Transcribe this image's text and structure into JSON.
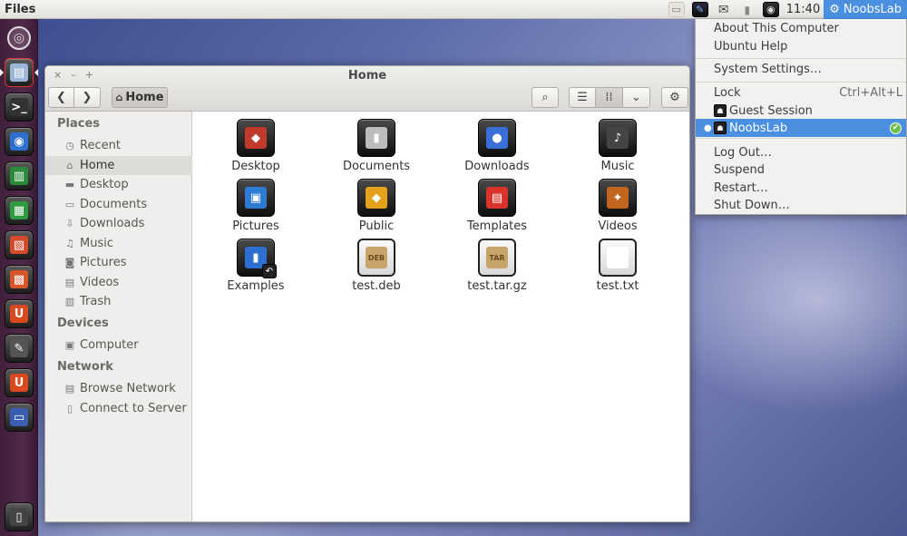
{
  "top_panel": {
    "app_title": "Files",
    "clock": "11:40",
    "session_label": "NoobsLab",
    "indicators": [
      "keyboard-icon",
      "pidgin-icon",
      "mail-icon",
      "battery-icon",
      "sound-icon"
    ]
  },
  "launcher": {
    "items": [
      {
        "name": "dash-home-icon",
        "glyph": "◎"
      },
      {
        "name": "files-app-icon",
        "glyph": "▤"
      },
      {
        "name": "terminal-icon",
        "glyph": ">_"
      },
      {
        "name": "firefox-icon",
        "glyph": "◉"
      },
      {
        "name": "libreoffice-writer-icon",
        "glyph": "▥"
      },
      {
        "name": "libreoffice-calc-icon",
        "glyph": "▦"
      },
      {
        "name": "libreoffice-impress-icon",
        "glyph": "▧"
      },
      {
        "name": "software-center-icon",
        "glyph": "▩"
      },
      {
        "name": "ubuntu-one-icon",
        "glyph": "U"
      },
      {
        "name": "system-settings-icon",
        "glyph": "✎"
      },
      {
        "name": "ubuntu-one-music-icon",
        "glyph": "U"
      },
      {
        "name": "workspace-switcher-icon",
        "glyph": "▭"
      },
      {
        "name": "trash-icon",
        "glyph": "▯"
      }
    ]
  },
  "window": {
    "title": "Home",
    "controls": {
      "close": "×",
      "minimize": "–",
      "maximize": "+"
    },
    "toolbar": {
      "back_glyph": "❮",
      "forward_glyph": "❯",
      "home_label": "Home",
      "home_glyph": "⌂",
      "search_glyph": "⌕",
      "list_glyph": "☰",
      "grid_glyph": "⁞⁞",
      "menu_glyph": "⌄",
      "gear_glyph": "⚙"
    }
  },
  "sidebar": {
    "places_header": "Places",
    "places": [
      {
        "label": "Recent",
        "icon": "recent-icon",
        "glyph": "◷"
      },
      {
        "label": "Home",
        "icon": "home-icon",
        "glyph": "⌂"
      },
      {
        "label": "Desktop",
        "icon": "desktop-folder-icon",
        "glyph": "▬"
      },
      {
        "label": "Documents",
        "icon": "documents-icon",
        "glyph": "▭"
      },
      {
        "label": "Downloads",
        "icon": "downloads-icon",
        "glyph": "⇩"
      },
      {
        "label": "Music",
        "icon": "music-icon",
        "glyph": "♫"
      },
      {
        "label": "Pictures",
        "icon": "pictures-icon",
        "glyph": "◙"
      },
      {
        "label": "Videos",
        "icon": "videos-icon",
        "glyph": "▤"
      },
      {
        "label": "Trash",
        "icon": "trash-icon",
        "glyph": "▥"
      }
    ],
    "devices_header": "Devices",
    "devices": [
      {
        "label": "Computer",
        "icon": "computer-icon",
        "glyph": "▣"
      }
    ],
    "network_header": "Network",
    "network": [
      {
        "label": "Browse Network",
        "icon": "network-icon",
        "glyph": "▤"
      },
      {
        "label": "Connect to Server",
        "icon": "server-icon",
        "glyph": "▯"
      }
    ]
  },
  "files": [
    {
      "name": "Desktop",
      "icon": "desktop-folder-icon",
      "glyph": "◆",
      "color": "#c0392b",
      "kind": "folder"
    },
    {
      "name": "Documents",
      "icon": "documents-folder-icon",
      "glyph": "▮",
      "color": "#bdbdbd",
      "kind": "folder"
    },
    {
      "name": "Downloads",
      "icon": "downloads-folder-icon",
      "glyph": "●",
      "color": "#3a6fd8",
      "kind": "folder"
    },
    {
      "name": "Music",
      "icon": "music-folder-icon",
      "glyph": "♪",
      "color": "#444444",
      "kind": "folder"
    },
    {
      "name": "Pictures",
      "icon": "pictures-folder-icon",
      "glyph": "▣",
      "color": "#2e7bd6",
      "kind": "folder"
    },
    {
      "name": "Public",
      "icon": "public-folder-icon",
      "glyph": "◆",
      "color": "#e5a11a",
      "kind": "folder"
    },
    {
      "name": "Templates",
      "icon": "templates-folder-icon",
      "glyph": "▤",
      "color": "#d9342b",
      "kind": "folder"
    },
    {
      "name": "Videos",
      "icon": "videos-folder-icon",
      "glyph": "✦",
      "color": "#c2661f",
      "kind": "folder"
    },
    {
      "name": "Examples",
      "icon": "examples-link-icon",
      "glyph": "▮",
      "color": "#2d6fd0",
      "kind": "link"
    },
    {
      "name": "test.deb",
      "icon": "deb-package-icon",
      "glyph": "DEB",
      "color": "#c8a46a",
      "kind": "doc"
    },
    {
      "name": "test.tar.gz",
      "icon": "tar-archive-icon",
      "glyph": "TAR",
      "color": "#c8a46a",
      "kind": "doc"
    },
    {
      "name": "test.txt",
      "icon": "text-file-icon",
      "glyph": "",
      "color": "#ffffff",
      "kind": "doc"
    }
  ],
  "session_menu": {
    "items": [
      {
        "label": "About This Computer",
        "accel": ""
      },
      {
        "label": "Ubuntu Help",
        "accel": ""
      },
      {
        "label": "System Settings…",
        "accel": ""
      },
      {
        "label": "Lock",
        "accel": "Ctrl+Alt+L"
      },
      {
        "label": "Guest Session",
        "accel": ""
      },
      {
        "label": "NoobsLab",
        "accel": ""
      },
      {
        "label": "Log Out…",
        "accel": ""
      },
      {
        "label": "Suspend",
        "accel": ""
      },
      {
        "label": "Restart…",
        "accel": ""
      },
      {
        "label": "Shut Down…",
        "accel": ""
      }
    ]
  },
  "colors": {
    "accent": "#4a8fe0",
    "launcher_bg": "#52294a",
    "check_green": "#6cc04a"
  }
}
